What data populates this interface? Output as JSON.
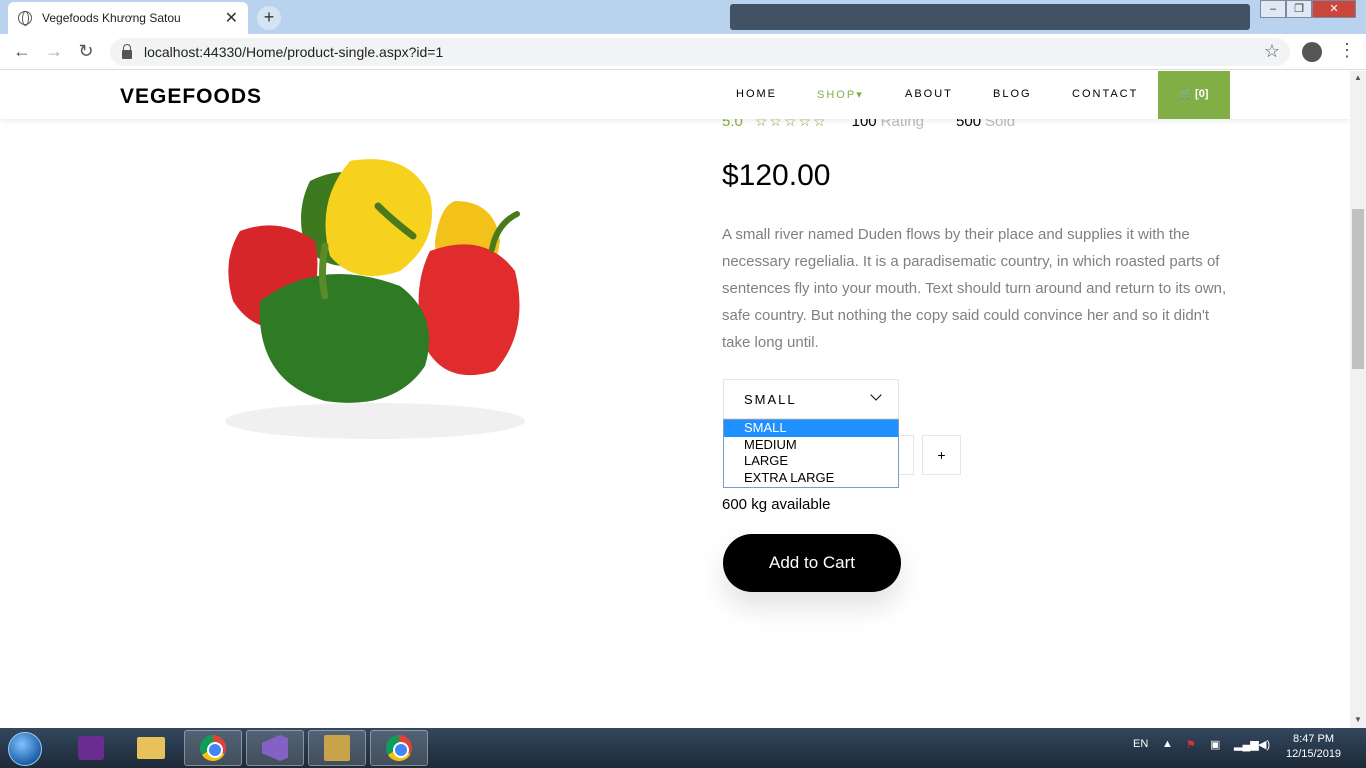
{
  "browser": {
    "active_tab_title": "Vegefoods Khương Satou",
    "tab_close": "✕",
    "new_tab": "+",
    "url": "localhost:44330/Home/product-single.aspx?id=1",
    "window_controls": [
      "‒",
      "❐",
      "✕"
    ]
  },
  "navbar": {
    "brand": "VEGEFOODS",
    "items": [
      "HOME",
      "SHOP",
      "ABOUT",
      "BLOG",
      "CONTACT"
    ],
    "shop_caret": "▾",
    "cart_label": "[0]",
    "cart_icon": "🛒",
    "accent_color": "#82ae46"
  },
  "product": {
    "rating_value": "5.0",
    "stars": "☆☆☆☆☆",
    "rating_count": "100",
    "rating_label": "Rating",
    "sold_count": "500",
    "sold_label": "Sold",
    "price": "$120.00",
    "description": "A small river named Duden flows by their place and supplies it with the necessary regelialia. It is a paradisematic country, in which roasted parts of sentences fly into your mouth. Text should turn around and return to its own, safe country. But nothing the copy said could convince her and so it didn't take long until.",
    "size_select": {
      "selected": "SMALL",
      "options": [
        "SMALL",
        "MEDIUM",
        "LARGE",
        "EXTRA LARGE"
      ],
      "highlight_color": "#1e90ff"
    },
    "qty_plus": "+",
    "availability": "600 kg available",
    "add_to_cart": "Add to Cart"
  },
  "taskbar": {
    "language": "EN",
    "time": "8:47 PM",
    "date": "12/15/2019"
  }
}
